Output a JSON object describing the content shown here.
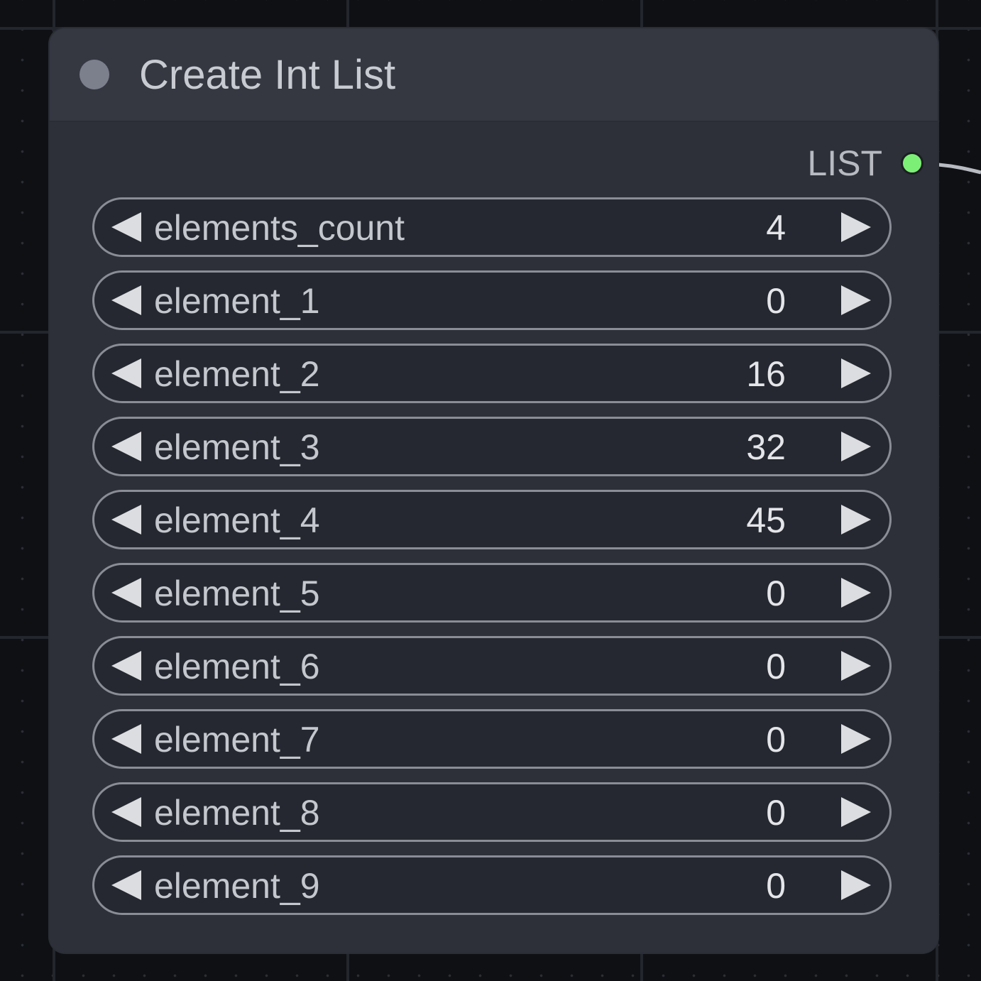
{
  "node": {
    "title": "Create Int List",
    "output": {
      "label": "LIST",
      "slot_color": "#7cf076"
    }
  },
  "widgets": [
    {
      "label": "elements_count",
      "value": "4"
    },
    {
      "label": "element_1",
      "value": "0"
    },
    {
      "label": "element_2",
      "value": "16"
    },
    {
      "label": "element_3",
      "value": "32"
    },
    {
      "label": "element_4",
      "value": "45"
    },
    {
      "label": "element_5",
      "value": "0"
    },
    {
      "label": "element_6",
      "value": "0"
    },
    {
      "label": "element_7",
      "value": "0"
    },
    {
      "label": "element_8",
      "value": "0"
    },
    {
      "label": "element_9",
      "value": "0"
    }
  ],
  "icons": {
    "collapse": "collapse-dot-icon",
    "decrement": "triangle-left-icon",
    "increment": "triangle-right-icon"
  }
}
